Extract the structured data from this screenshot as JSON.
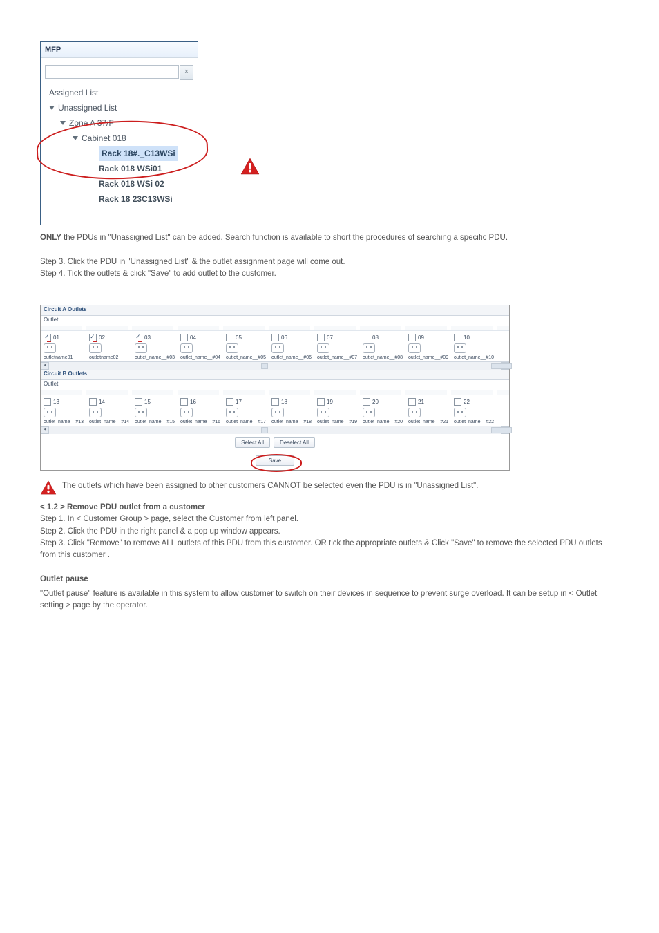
{
  "mfp": {
    "title": "MFP",
    "search_placeholder": "",
    "clear_symbol": "×",
    "items": {
      "assigned": "Assigned List",
      "unassigned": "Unassigned List",
      "zone": "Zone A 37/F",
      "cabinet": "Cabinet 018",
      "r1": "Rack 18#._C13WSi",
      "r2": "Rack 018 WSi01",
      "r3": "Rack 018 WSi 02",
      "r4": "Rack 18 23C13WSi"
    }
  },
  "caution1": {
    "bold": "ONLY",
    "text_a": " the PDUs in \"Unassigned List\" can be added. Search function is available to short the procedures of searching a specific PDU.",
    "step3": "Step 3. Click the PDU in \"Unassigned List\" & the outlet assignment page will come out.",
    "step4": "Step 4. Tick the outlets & click \"Save\" to add outlet to the customer."
  },
  "circuits": {
    "a_header": "Circuit A Outlets",
    "b_header": "Circuit B Outlets",
    "outlet_label": "Outlet",
    "a": [
      {
        "num": "01",
        "name": "outletname01",
        "checked": true,
        "red": true
      },
      {
        "num": "02",
        "name": "outletname02",
        "checked": true,
        "red": true
      },
      {
        "num": "03",
        "name": "outlet_name__#03",
        "checked": true,
        "red": true
      },
      {
        "num": "04",
        "name": "outlet_name__#04",
        "checked": false,
        "red": false
      },
      {
        "num": "05",
        "name": "outlet_name__#05",
        "checked": false,
        "red": false
      },
      {
        "num": "06",
        "name": "outlet_name__#06",
        "checked": false,
        "red": false
      },
      {
        "num": "07",
        "name": "outlet_name__#07",
        "checked": false,
        "red": false
      },
      {
        "num": "08",
        "name": "outlet_name__#08",
        "checked": false,
        "red": false
      },
      {
        "num": "09",
        "name": "outlet_name__#09",
        "checked": false,
        "red": false
      },
      {
        "num": "10",
        "name": "outlet_name__#10",
        "checked": false,
        "red": false
      }
    ],
    "b": [
      {
        "num": "13",
        "name": "outlet_name__#13",
        "checked": false
      },
      {
        "num": "14",
        "name": "outlet_name__#14",
        "checked": false
      },
      {
        "num": "15",
        "name": "outlet_name__#15",
        "checked": false
      },
      {
        "num": "16",
        "name": "outlet_name__#16",
        "checked": false
      },
      {
        "num": "17",
        "name": "outlet_name__#17",
        "checked": false
      },
      {
        "num": "18",
        "name": "outlet_name__#18",
        "checked": false
      },
      {
        "num": "19",
        "name": "outlet_name__#19",
        "checked": false
      },
      {
        "num": "20",
        "name": "outlet_name__#20",
        "checked": false
      },
      {
        "num": "21",
        "name": "outlet_name__#21",
        "checked": false
      },
      {
        "num": "22",
        "name": "outlet_name__#22",
        "checked": false
      }
    ],
    "select_all": "Select All",
    "deselect_all": "Deselect All",
    "save": "Save"
  },
  "lower": {
    "note1": "The outlets which have been assigned to other customers CANNOT be selected even the PDU is in \"Unassigned List\".",
    "hdr": "< 1.2 > Remove PDU outlet from a customer",
    "step1": "Step 1. In < Customer Group > page, select the Customer from left panel.",
    "step2": "Step 2. Click the PDU in the right panel & a pop up window appears.",
    "step3": "Step 3. Click \"Remove\" to remove ALL outlets of this PDU from this customer. OR tick the appropriate outlets & Click \"Save\" to remove the selected PDU outlets from this customer .",
    "pause": "Outlet pause",
    "pause_text": "\"Outlet pause\" feature is available in this system to allow customer to switch on their devices in sequence to prevent surge overload. It can be setup in < Outlet setting > page by the operator."
  }
}
